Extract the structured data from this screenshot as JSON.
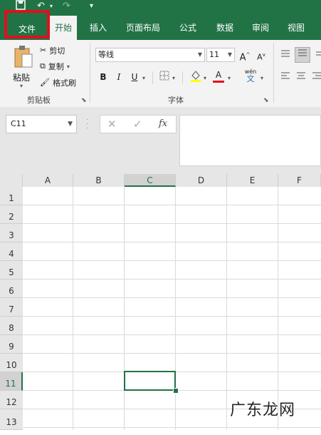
{
  "quick_access": {
    "save_icon": "save-icon",
    "undo_icon": "undo-icon",
    "redo_icon": "redo-icon",
    "customize_icon": "customize-icon"
  },
  "tabs": [
    {
      "label": "文件"
    },
    {
      "label": "开始"
    },
    {
      "label": "插入"
    },
    {
      "label": "页面布局"
    },
    {
      "label": "公式"
    },
    {
      "label": "数据"
    },
    {
      "label": "审阅"
    },
    {
      "label": "视图"
    }
  ],
  "clipboard": {
    "paste_label": "粘贴",
    "cut_label": "剪切",
    "copy_label": "复制",
    "format_painter_label": "格式刷",
    "group_label": "剪贴板"
  },
  "font": {
    "font_name": "等线",
    "font_size": "11",
    "grow_label": "A",
    "shrink_label": "A",
    "bold_label": "B",
    "italic_label": "I",
    "underline_label": "U",
    "font_color_label": "A",
    "phonetic_label": "wén",
    "phonetic_char": "文",
    "group_label": "字体"
  },
  "formula_bar": {
    "name_box": "C11",
    "fx_label": "fx"
  },
  "grid": {
    "columns": [
      "A",
      "B",
      "C",
      "D",
      "E",
      "F"
    ],
    "rows": [
      "1",
      "2",
      "3",
      "4",
      "5",
      "6",
      "7",
      "8",
      "9",
      "10",
      "11",
      "12",
      "13"
    ],
    "active_column": "C",
    "active_row": "11"
  },
  "watermark": "广东龙网",
  "colors": {
    "accent": "#217346",
    "highlight_box": "#e0101b"
  }
}
